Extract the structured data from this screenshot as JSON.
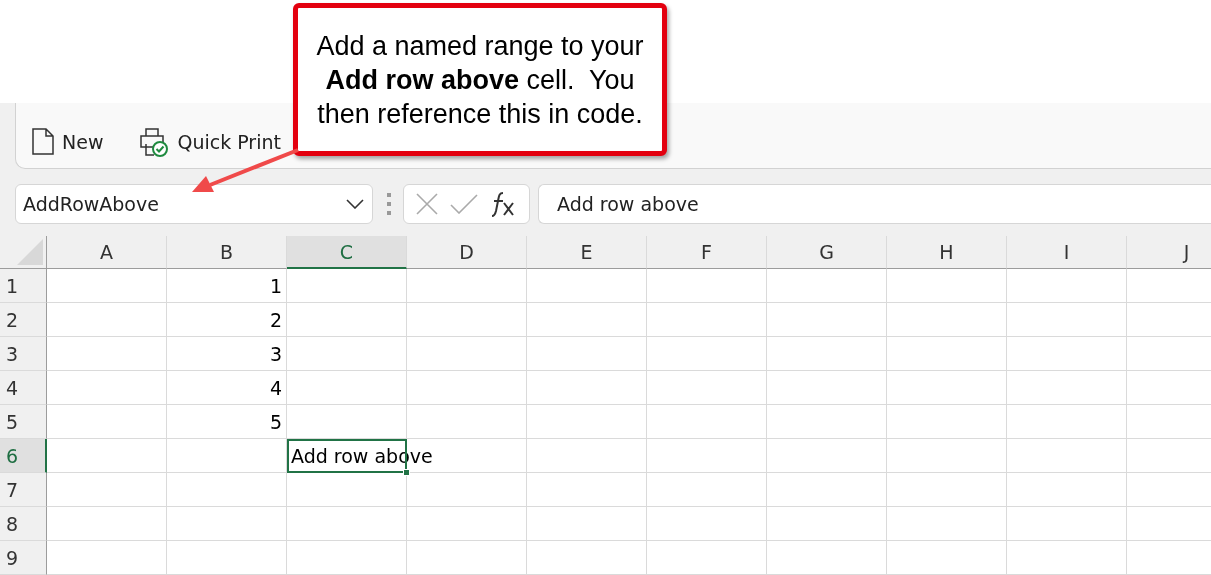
{
  "callout": {
    "text": "Add a named range to your **Add row above** cell.  You then reference this in code."
  },
  "ribbon": {
    "buttons": [
      {
        "label": "New",
        "kind": "document"
      },
      {
        "label": "Quick Print",
        "kind": "printer"
      }
    ]
  },
  "name_box": {
    "value": "AddRowAbove"
  },
  "formula_bar": {
    "value": "Add row above"
  },
  "sheet": {
    "columns": [
      {
        "label": "A",
        "selected": false
      },
      {
        "label": "B",
        "selected": false
      },
      {
        "label": "C",
        "selected": true
      },
      {
        "label": "D",
        "selected": false
      },
      {
        "label": "E",
        "selected": false
      },
      {
        "label": "F",
        "selected": false
      },
      {
        "label": "G",
        "selected": false
      },
      {
        "label": "H",
        "selected": false
      },
      {
        "label": "I",
        "selected": false
      },
      {
        "label": "J",
        "selected": false
      }
    ],
    "rows": [
      {
        "label": "1",
        "selected": false,
        "values": {
          "B": "1"
        }
      },
      {
        "label": "2",
        "selected": false,
        "values": {
          "B": "2"
        }
      },
      {
        "label": "3",
        "selected": false,
        "values": {
          "B": "3"
        }
      },
      {
        "label": "4",
        "selected": false,
        "values": {
          "B": "4"
        }
      },
      {
        "label": "5",
        "selected": false,
        "values": {
          "B": "5"
        }
      },
      {
        "label": "6",
        "selected": true,
        "values": {
          "C": "Add row above"
        }
      },
      {
        "label": "7",
        "selected": false,
        "values": {}
      },
      {
        "label": "8",
        "selected": false,
        "values": {}
      },
      {
        "label": "9",
        "selected": false,
        "values": {}
      }
    ]
  }
}
